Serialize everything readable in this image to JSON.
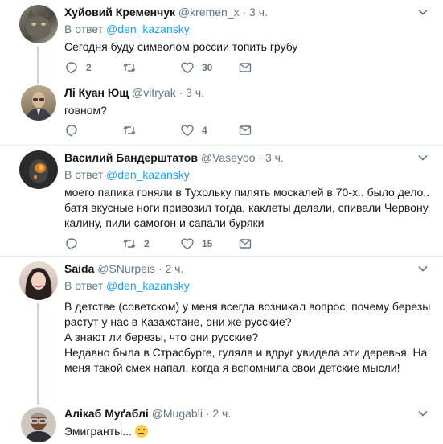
{
  "tweets": [
    {
      "name": "Хуйовий Кременчук",
      "handle": "@kremen_x",
      "time": "· 3 ч.",
      "reply_prefix": "В ответ",
      "reply_mention": "@den_kazansky",
      "text": "Сегодня буду символом россии топить грубу",
      "replies": "2",
      "retweets": "",
      "likes": "30"
    },
    {
      "name": "Лі Куан Ющ",
      "handle": "@vitryak",
      "time": "· 3 ч.",
      "text": "говном?",
      "replies": "",
      "retweets": "",
      "likes": "4"
    },
    {
      "name": "Василий Бандерштатов",
      "handle": "@Vaseyoo",
      "time": "· 3 ч.",
      "reply_prefix": "В ответ",
      "reply_mention": "@den_kazansky",
      "text": "моего папика гоняли в Тухольку пилять москалей в 70-х.. было дело.. батя вкусные ноги привозил тогда, каклеты делали, спивали Червону калину, пили самогон и сапали буряки",
      "replies": "",
      "retweets": "2",
      "likes": "15"
    },
    {
      "name": "Saida",
      "handle": "@SNurpeis",
      "time": "· 2 ч.",
      "reply_prefix": "В ответ",
      "reply_mention": "@den_kazansky",
      "text_lines": [
        "В детстве (советском) у меня всегда возникал вопрос, почему березы растут у нас в Казахстане, они же русские?",
        "А знают ли березы, что они русские?",
        "Недавно была в Страсбурге, гулялв и вдруг увидела эти деревья. На меня такой смех напал, когда я вспомнила свои детские мысли!"
      ],
      "replies": "",
      "retweets": "",
      "likes": ""
    },
    {
      "name": "Алікаб Муґаблі",
      "handle": "@Mugabli",
      "time": "· 2 ч.",
      "text": "Эмигранты...",
      "emoji": "thinking-face-emoji"
    }
  ],
  "colors": {
    "text": "#14171a",
    "muted": "#657786",
    "link": "#1da1f2",
    "divider": "#e6ecf0",
    "thread_line": "#ccd6dd"
  }
}
